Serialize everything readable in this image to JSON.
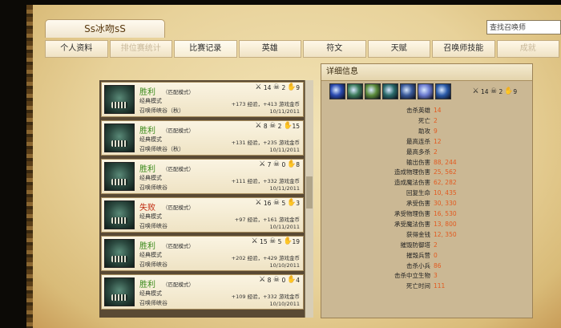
{
  "summoner_name": "Ss冰吻sS",
  "search_placeholder": "查找召唤师",
  "tabs": [
    {
      "label": "个人资料",
      "state": "normal"
    },
    {
      "label": "排位赛统计",
      "state": "disabled"
    },
    {
      "label": "比赛记录",
      "state": "active"
    },
    {
      "label": "英雄",
      "state": "normal"
    },
    {
      "label": "符文",
      "state": "normal"
    },
    {
      "label": "天赋",
      "state": "normal"
    },
    {
      "label": "召唤师技能",
      "state": "normal"
    },
    {
      "label": "成就",
      "state": "disabled"
    }
  ],
  "matches": [
    {
      "result": "胜利",
      "win": true,
      "mode_note": "（匹配模式）",
      "type": "经典模式",
      "map": "召唤师峡谷（秋）",
      "kills": "14",
      "deaths": "2",
      "assists": "9",
      "rewards": "+173 经验，+413 游戏金币",
      "date": "10/11/2011"
    },
    {
      "result": "胜利",
      "win": true,
      "mode_note": "（匹配模式）",
      "type": "经典模式",
      "map": "召唤师峡谷（秋）",
      "kills": "8",
      "deaths": "2",
      "assists": "15",
      "rewards": "+131 经验，+235 游戏金币",
      "date": "10/11/2011"
    },
    {
      "result": "胜利",
      "win": true,
      "mode_note": "（匹配模式）",
      "type": "经典模式",
      "map": "召唤师峡谷",
      "kills": "7",
      "deaths": "0",
      "assists": "8",
      "rewards": "+111 经验，+332 游戏金币",
      "date": "10/11/2011"
    },
    {
      "result": "失败",
      "win": false,
      "mode_note": "（匹配模式）",
      "type": "经典模式",
      "map": "召唤师峡谷",
      "kills": "16",
      "deaths": "5",
      "assists": "3",
      "rewards": "+97 经验，+161 游戏金币",
      "date": "10/11/2011"
    },
    {
      "result": "胜利",
      "win": true,
      "mode_note": "（匹配模式）",
      "type": "经典模式",
      "map": "召唤师峡谷",
      "kills": "15",
      "deaths": "5",
      "assists": "19",
      "rewards": "+202 经验，+429 游戏金币",
      "date": "10/10/2011"
    },
    {
      "result": "胜利",
      "win": true,
      "mode_note": "（匹配模式）",
      "type": "经典模式",
      "map": "召唤师峡谷",
      "kills": "8",
      "deaths": "0",
      "assists": "4",
      "rewards": "+109 经验，+332 游戏金币",
      "date": "10/10/2011"
    }
  ],
  "detail": {
    "title": "详细信息",
    "item_colors": [
      "#2a4ab0",
      "#3c7a5a",
      "#5a8a3a",
      "#2a6a6a",
      "#3a5a9a",
      "#6a7ad0",
      "#2a5aa8"
    ],
    "kills": "14",
    "deaths": "2",
    "assists": "9",
    "stats": [
      {
        "label": "击杀英雄",
        "value": "14"
      },
      {
        "label": "死亡",
        "value": "2"
      },
      {
        "label": "助攻",
        "value": "9"
      },
      {
        "label": "最高连杀",
        "value": "12"
      },
      {
        "label": "最高多杀",
        "value": "2"
      },
      {
        "label": "输出伤害",
        "value": "88, 244"
      },
      {
        "label": "造成物理伤害",
        "value": "25, 562"
      },
      {
        "label": "造成魔法伤害",
        "value": "62, 282"
      },
      {
        "label": "回复生命",
        "value": "10, 435"
      },
      {
        "label": "承受伤害",
        "value": "30, 330"
      },
      {
        "label": "承受物理伤害",
        "value": "16, 530"
      },
      {
        "label": "承受魔法伤害",
        "value": "13, 800"
      },
      {
        "label": "获得金钱",
        "value": "12, 350"
      },
      {
        "label": "摧毁防御塔",
        "value": "2"
      },
      {
        "label": "摧毁兵营",
        "value": "0"
      },
      {
        "label": "击杀小兵",
        "value": "86"
      },
      {
        "label": "击杀中立生物",
        "value": "3"
      },
      {
        "label": "死亡时间",
        "value": "111"
      }
    ]
  },
  "colors": {
    "win": "#3a8a1a",
    "loss": "#c02a10",
    "stat_value": "#e25a20"
  }
}
